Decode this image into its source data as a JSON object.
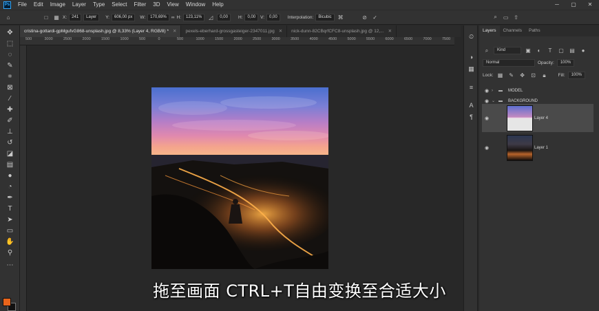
{
  "menubar": {
    "logo": "Ps",
    "items": [
      "File",
      "Edit",
      "Image",
      "Layer",
      "Type",
      "Select",
      "Filter",
      "3D",
      "View",
      "Window",
      "Help"
    ],
    "win_controls": [
      "─",
      "▢",
      "✕"
    ]
  },
  "options": {
    "ref_x": "X:",
    "ref_x_val": "241",
    "layer_sel": "Layer",
    "y_label": "Y:",
    "y_val": "606,00 px",
    "w_label": "W:",
    "w_val": "170,69%",
    "link": "∞",
    "h_label": "H:",
    "h_val": "123,11%",
    "angle_val": "0,00",
    "hskew_label": "H:",
    "hskew_val": "0,00",
    "vskew_label": "V:",
    "vskew_val": "0,00",
    "interp_label": "Interpolation:",
    "interp_val": "Bicubic"
  },
  "tabs": [
    {
      "label": "cristina-gottardi-gpMgufvG868-unsplash.jpg @ 8,33% (Layer 4, RGB/8) *",
      "active": true
    },
    {
      "label": "pexels-eberhard-grossgasteiger-2347011.jpg",
      "active": false
    },
    {
      "label": "nick-dunn-82CBqrfCFC8-unsplash.jpg @ 12,...",
      "active": false
    }
  ],
  "ruler_ticks": [
    "500",
    "3000",
    "2500",
    "2000",
    "1500",
    "1000",
    "500",
    "0",
    "500",
    "1000",
    "1500",
    "2000",
    "2500",
    "3000",
    "3500",
    "4000",
    "4500",
    "5000",
    "5500",
    "6000",
    "6500",
    "7000",
    "7500"
  ],
  "panel": {
    "tabs": [
      "Layers",
      "Channels",
      "Paths"
    ],
    "kind_label": "Kind",
    "blend_mode": "Normal",
    "opacity_label": "Opacity:",
    "opacity_val": "100%",
    "lock_label": "Lock:",
    "fill_label": "Fill:",
    "fill_val": "100%",
    "layers": [
      {
        "name": "MODEL",
        "type": "group",
        "expanded": false
      },
      {
        "name": "BACKGROUND",
        "type": "group",
        "expanded": true
      },
      {
        "name": "Layer 4",
        "type": "layer",
        "selected": true
      },
      {
        "name": "Layer 1",
        "type": "layer",
        "selected": false
      }
    ]
  },
  "subtitle": "拖至画面 CTRL+T自由变换至合适大小",
  "colors": {
    "foreground": "#e8641b",
    "background": "#111111",
    "accent": "#31a8ff"
  }
}
